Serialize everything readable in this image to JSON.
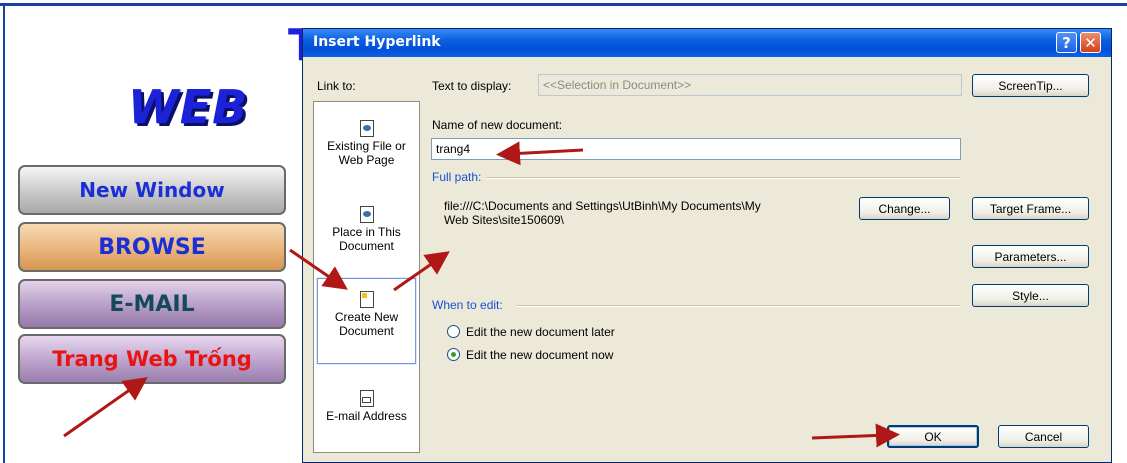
{
  "background": {
    "title_partial": "WEB",
    "title_top_partial": "T",
    "buttons": [
      {
        "label": "New Window"
      },
      {
        "label": "BROWSE"
      },
      {
        "label": "E-MAIL"
      },
      {
        "label": "Trang Web Trống"
      }
    ]
  },
  "dialog": {
    "title": "Insert Hyperlink",
    "help_glyph": "?",
    "close_glyph": "✕",
    "link_to_label": "Link to:",
    "link_items": [
      {
        "label_lines": [
          "Existing File or",
          "Web Page"
        ],
        "icon": "existing-file-icon"
      },
      {
        "label_lines": [
          "Place in This",
          "Document"
        ],
        "icon": "place-in-document-icon"
      },
      {
        "label_lines": [
          "Create New",
          "Document"
        ],
        "icon": "create-new-document-icon",
        "selected": true
      },
      {
        "label_lines": [
          "E-mail Address"
        ],
        "icon": "email-address-icon"
      }
    ],
    "text_to_display_label": "Text to display:",
    "text_to_display_value": "<<Selection in Document>>",
    "screentip_button": "ScreenTip...",
    "name_of_new_document_label": "Name of new document:",
    "name_of_new_document_value": "trang4",
    "full_path_label": "Full path:",
    "full_path_value_line1": "file:///C:\\Documents and Settings\\UtBinh\\My Documents\\My",
    "full_path_value_line2": "Web Sites\\site150609\\",
    "change_button": "Change...",
    "target_frame_button": "Target Frame...",
    "parameters_button": "Parameters...",
    "style_button": "Style...",
    "when_to_edit_label": "When to edit:",
    "edit_later_label": "Edit the new document later",
    "edit_now_label": "Edit the new document now",
    "edit_now_selected": true,
    "ok_button": "OK",
    "cancel_button": "Cancel"
  },
  "colors": {
    "titlebar": "#0350d8",
    "accent_blue": "#1a4fd6",
    "annotation_arrow": "#b01818"
  }
}
